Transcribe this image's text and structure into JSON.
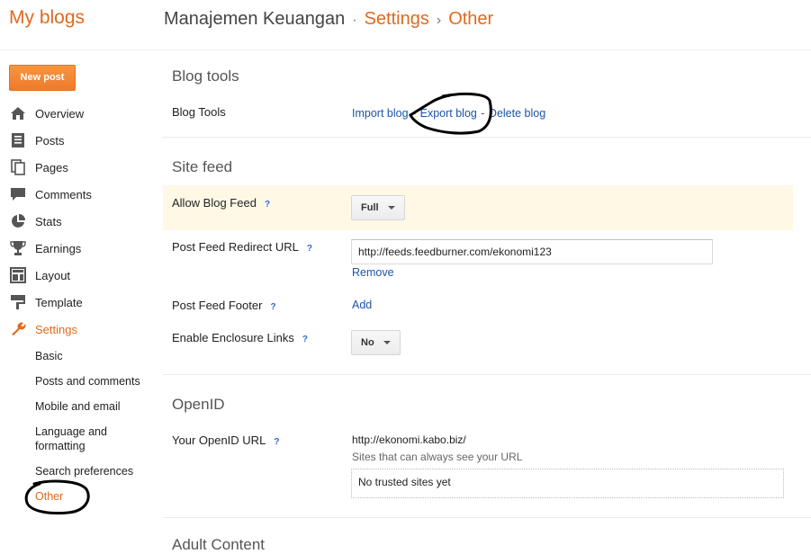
{
  "header": {
    "brand": "My blogs",
    "breadcrumb": [
      "Manajemen Keuangan",
      "Settings",
      "Other"
    ],
    "separator": "·",
    "separator2": "›"
  },
  "sidebar": {
    "new_post": "New post",
    "items": [
      {
        "label": "Overview",
        "icon": "home-icon"
      },
      {
        "label": "Posts",
        "icon": "posts-icon"
      },
      {
        "label": "Pages",
        "icon": "pages-icon"
      },
      {
        "label": "Comments",
        "icon": "comments-icon"
      },
      {
        "label": "Stats",
        "icon": "stats-icon"
      },
      {
        "label": "Earnings",
        "icon": "trophy-icon"
      },
      {
        "label": "Layout",
        "icon": "layout-icon"
      },
      {
        "label": "Template",
        "icon": "template-icon"
      },
      {
        "label": "Settings",
        "icon": "wrench-icon"
      }
    ],
    "settings_sub": [
      "Basic",
      "Posts and comments",
      "Mobile and email",
      "Language and formatting",
      "Search preferences",
      "Other"
    ],
    "active_item": "Settings",
    "active_sub": "Other"
  },
  "blog_tools": {
    "title": "Blog tools",
    "label": "Blog Tools",
    "import": "Import blog",
    "export": "Export blog",
    "delete": "Delete blog",
    "dash": "-"
  },
  "site_feed": {
    "title": "Site feed",
    "allow_label": "Allow Blog Feed",
    "allow_value": "Full",
    "redirect_label": "Post Feed Redirect URL",
    "redirect_value": "http://feeds.feedburner.com/ekonomi123",
    "remove": "Remove",
    "footer_label": "Post Feed Footer",
    "footer_add": "Add",
    "enclosure_label": "Enable Enclosure Links",
    "enclosure_value": "No",
    "help": "?"
  },
  "openid": {
    "title": "OpenID",
    "url_label": "Your OpenID URL",
    "url_value": "http://ekonomi.kabo.biz/",
    "trusted_caption": "Sites that can always see your URL",
    "trusted_empty": "No trusted sites yet"
  },
  "adult": {
    "title": "Adult Content"
  },
  "colors": {
    "accent": "#e06a1d",
    "link": "#1a55a8",
    "highlight": "#fff8e5",
    "button": "#f1883c"
  }
}
